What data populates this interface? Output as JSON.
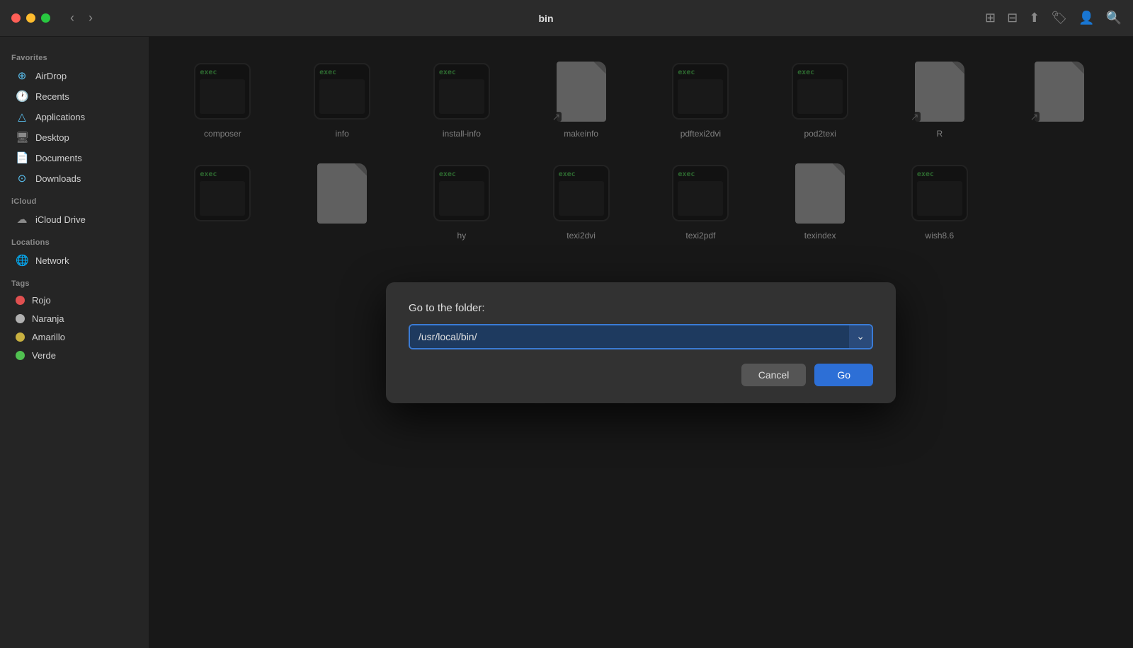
{
  "titlebar": {
    "title": "bin",
    "back_label": "‹",
    "forward_label": "›"
  },
  "sidebar": {
    "favorites_label": "Favorites",
    "icloud_label": "iCloud",
    "locations_label": "Locations",
    "tags_label": "Tags",
    "favorites_items": [
      {
        "id": "airdrop",
        "label": "AirDrop",
        "icon": "📡"
      },
      {
        "id": "recents",
        "label": "Recents",
        "icon": "🕐"
      },
      {
        "id": "applications",
        "label": "Applications",
        "icon": "🅰"
      },
      {
        "id": "desktop",
        "label": "Desktop",
        "icon": "🖥"
      },
      {
        "id": "documents",
        "label": "Documents",
        "icon": "📄"
      },
      {
        "id": "downloads",
        "label": "Downloads",
        "icon": "⬇"
      }
    ],
    "icloud_items": [
      {
        "id": "icloud-drive",
        "label": "iCloud Drive",
        "icon": "☁"
      }
    ],
    "locations_items": [
      {
        "id": "network",
        "label": "Network",
        "icon": "🌐"
      }
    ],
    "tags": [
      {
        "id": "rojo",
        "label": "Rojo",
        "color": "#e05050"
      },
      {
        "id": "naranja",
        "label": "Naranja",
        "color": "#b0b0b0"
      },
      {
        "id": "amarillo",
        "label": "Amarillo",
        "color": "#c8b040"
      },
      {
        "id": "verde",
        "label": "Verde",
        "color": "#50c050"
      }
    ]
  },
  "files": [
    {
      "id": "composer",
      "name": "composer",
      "type": "exec"
    },
    {
      "id": "info",
      "name": "info",
      "type": "exec"
    },
    {
      "id": "install-info",
      "name": "install-info",
      "type": "exec"
    },
    {
      "id": "makeinfo",
      "name": "makeinfo",
      "type": "generic"
    },
    {
      "id": "pdftexi2dvi",
      "name": "pdftexi2dvi",
      "type": "exec"
    },
    {
      "id": "pod2texi",
      "name": "pod2texi",
      "type": "exec"
    },
    {
      "id": "R",
      "name": "R",
      "type": "generic",
      "alias": true
    },
    {
      "id": "r-script",
      "name": "",
      "type": "generic",
      "alias": true
    },
    {
      "id": "wish8.6-part",
      "name": "",
      "type": "exec"
    },
    {
      "id": "some-generic",
      "name": "",
      "type": "generic"
    },
    {
      "id": "some-exec2",
      "name": "",
      "type": "exec"
    },
    {
      "id": "texi2dvi",
      "name": "texi2dvi",
      "type": "exec"
    },
    {
      "id": "texi2pdf",
      "name": "texi2pdf",
      "type": "exec"
    },
    {
      "id": "texindex",
      "name": "texindex",
      "type": "generic"
    },
    {
      "id": "wish8.6",
      "name": "wish8.6",
      "type": "exec"
    }
  ],
  "modal": {
    "title": "Go to the folder:",
    "input_value": "/usr/local/bin/",
    "cancel_label": "Cancel",
    "go_label": "Go"
  }
}
